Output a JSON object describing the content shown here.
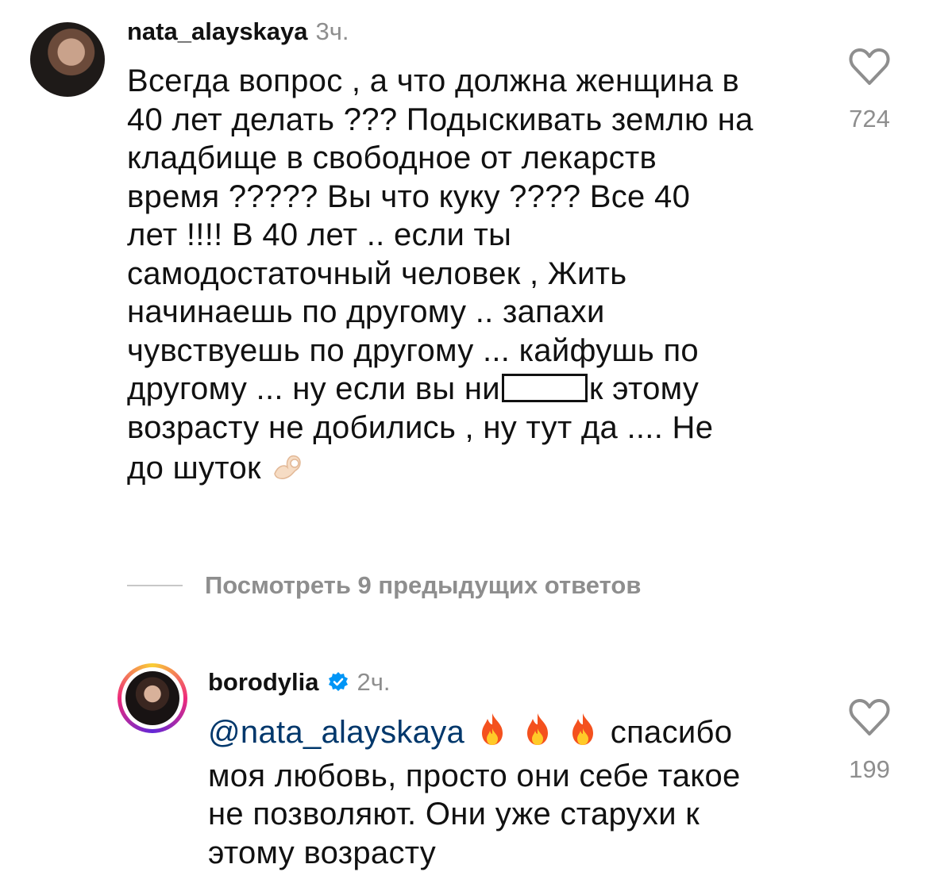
{
  "comment1": {
    "username": "nata_alayskaya",
    "time": "3ч.",
    "text_before_censor": "Всегда вопрос , а что должна женщина в\n40 лет делать ??? Подыскивать землю на\nкладбище в свободное от лекарств\nвремя ????? Вы что куку ???? Все 40\nлет !!!! В 40 лет .. если ты\nсамодостаточный человек , Жить\nначинаешь по другому .. запахи\nчувствуешь по другому ... кайфушь по\nдругому ... ну если вы ни",
    "text_after_censor": "к этому\nвозрасту не добились , ну тут да .... Не\nдо шуток ",
    "emoji": "ok-hand-emoji",
    "likes": "724"
  },
  "view_replies": {
    "label": "Посмотреть 9 предыдущих ответов"
  },
  "comment2": {
    "username": "borodylia",
    "verified": true,
    "time": "2ч.",
    "mention": "@nata_alayskaya",
    "emoji": [
      "fire-emoji",
      "fire-emoji",
      "fire-emoji"
    ],
    "text": "спасибо\nмоя любовь, просто они себе такое\nне позволяют. Они уже старухи к\nэтому возрасту",
    "likes": "199"
  },
  "colors": {
    "text": "#111111",
    "secondary": "#8e8e8e",
    "mention": "#00376b",
    "verified": "#0095f6"
  }
}
